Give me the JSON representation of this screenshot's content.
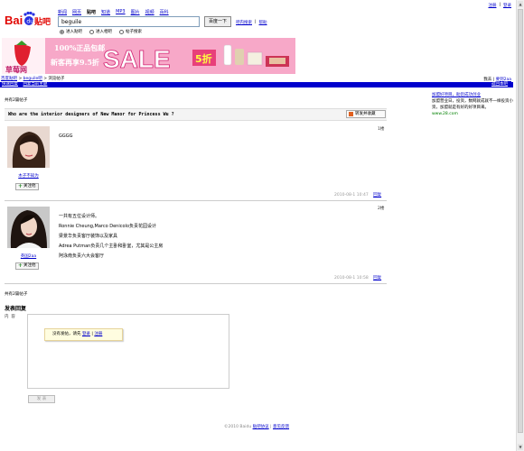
{
  "brand": {
    "logo_text": "Bai",
    "logo_suffix": "贴吧"
  },
  "nav": [
    "新闻",
    "网页",
    "贴吧",
    "知道",
    "MP3",
    "图片",
    "视频",
    "百科"
  ],
  "nav_current_index": 2,
  "search": {
    "value": "beguile",
    "button": "百度一下",
    "links": [
      "吧内搜索",
      "帮助"
    ]
  },
  "radios": [
    {
      "label": "进入贴吧",
      "checked": true
    },
    {
      "label": "进入相吧",
      "checked": false
    },
    {
      "label": "帖子搜索",
      "checked": false
    }
  ],
  "top_right": {
    "register": "注册",
    "sep": "|",
    "login": "登录"
  },
  "banner": {
    "brand": "草莓网",
    "line1": "100%正品包邮",
    "line2": "新客再享9.5折",
    "sale": "SALE",
    "discount": "5折"
  },
  "breadcrumb": {
    "home": "百度贴吧",
    "sep1": ">",
    "bar": "beguile吧",
    "sep2": ">",
    "current": "浏览帖子"
  },
  "user_right": {
    "label": "我去",
    "sep": "|",
    "name": "要到2aa"
  },
  "bluebar": {
    "left": [
      "快速回复",
      "回复当前主题"
    ],
    "right": "返回本吧"
  },
  "thread": {
    "count_top": "共有2篇帖子",
    "count_bottom": "共有2篇帖子",
    "title": "Who are the interior designers of New Manor for Princess Wu ?",
    "fav_label": "转发并收藏"
  },
  "ad": {
    "title": "加盟好项目，助您成功创业",
    "body": "加盟营业日，投资，数网就成就不一样投资小资，加盟就是有好的好项目来。",
    "url": "www.28.com"
  },
  "posts": [
    {
      "floor": "1楼",
      "user": "木子不知为",
      "follow": "关注他",
      "content": [
        "GGGG"
      ],
      "time": "2010-08-1 10:47",
      "reply": "回复"
    },
    {
      "floor": "2楼",
      "user": "英国2aa",
      "follow": "关注他",
      "content": [
        "一共有五位设计师。",
        "Ronnie Cheung,Marco Denicolo负责花园设计",
        "梁景华负责客厅装饰以及家具",
        "Adrea Putman负责几个主卧和卧室，尤其是公主房",
        "阿泳南负责六大会客厅"
      ],
      "time": "2010-08-1 10:58",
      "reply": "回复"
    }
  ],
  "reply": {
    "title": "发表回复",
    "label1": "内",
    "label2": "容",
    "tip_prefix": "没有发帖，请先",
    "tip_login": "登录",
    "tip_sep": "|",
    "tip_register": "注册",
    "submit": "发 表"
  },
  "footer": {
    "copyright": "©2010 Baidu",
    "link1": "贴吧协议",
    "link2": "意见反馈"
  }
}
